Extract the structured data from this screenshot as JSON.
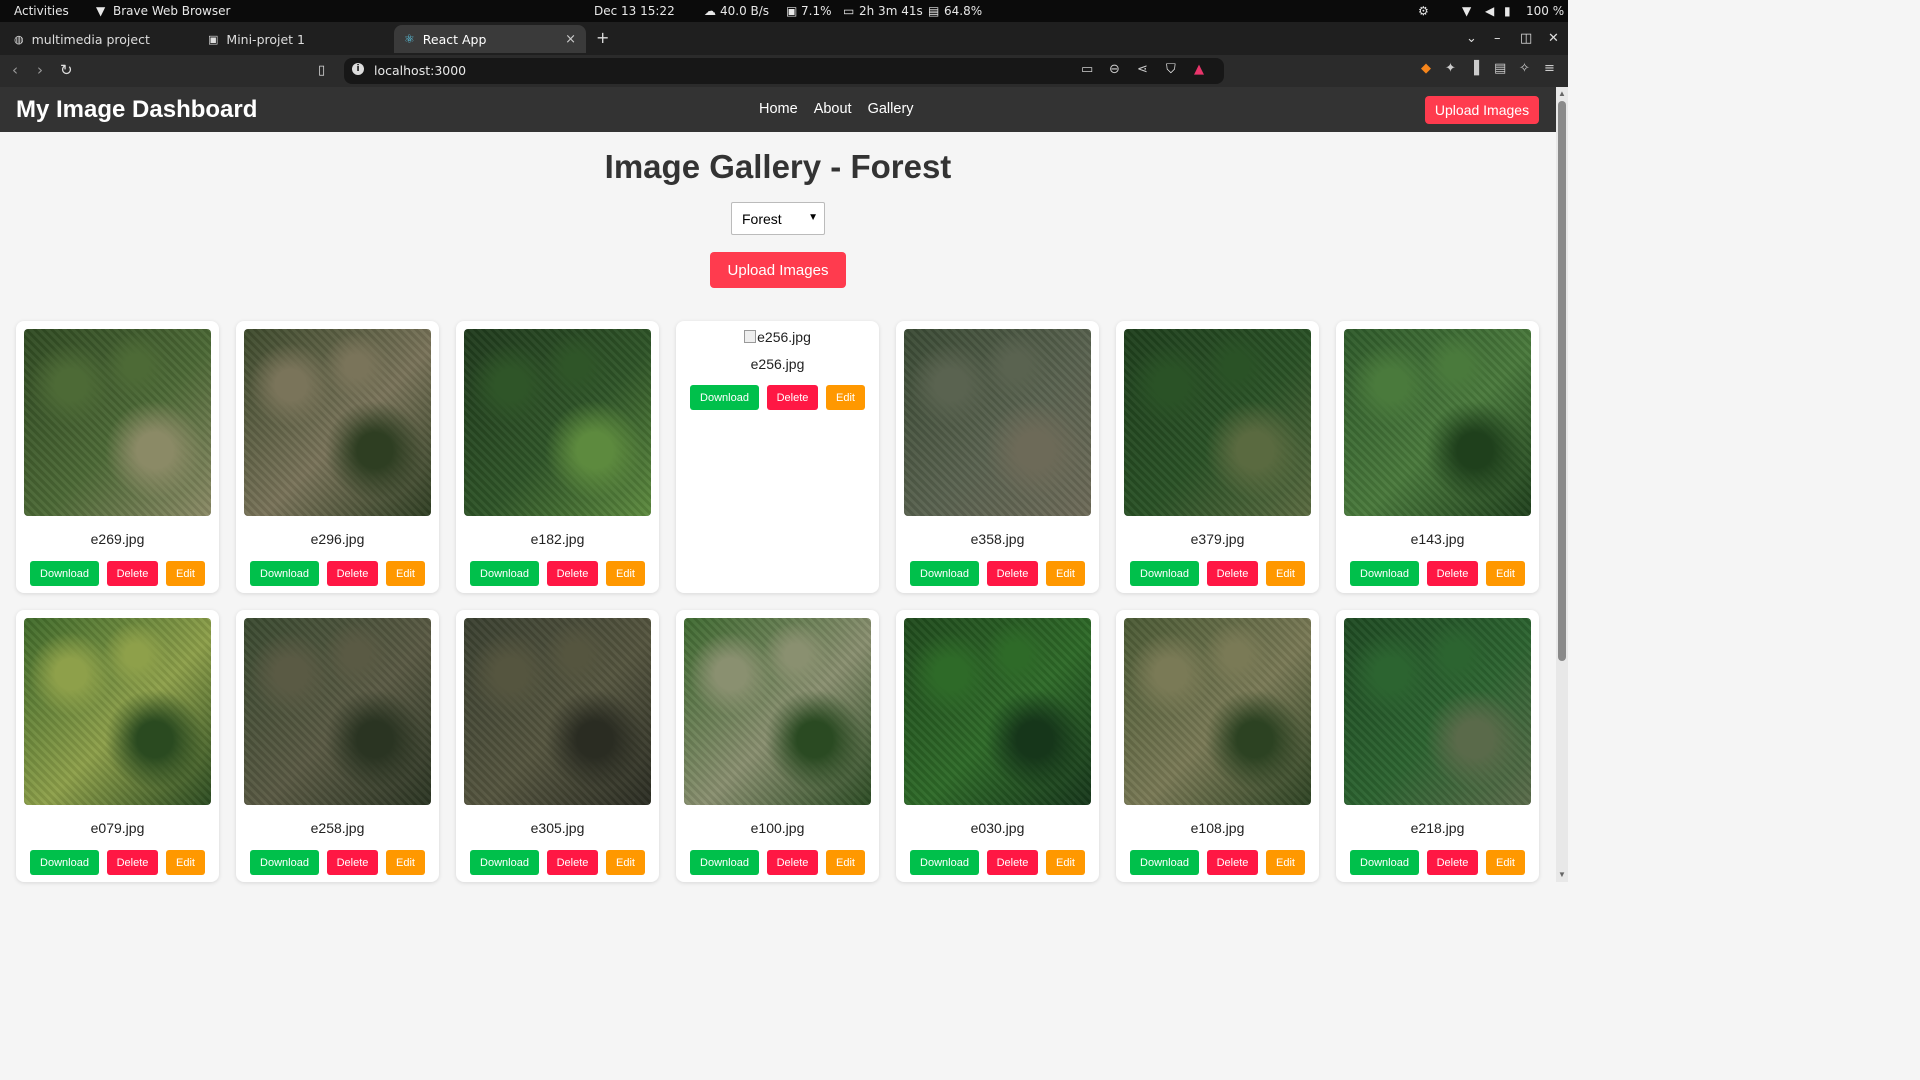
{
  "os_bar": {
    "activities": "Activities",
    "app_name": "Brave Web Browser",
    "datetime": "Dec 13  15:22",
    "net_speed": "40.0 B/s",
    "cpu": "7.1%",
    "uptime": "2h 3m 41s",
    "battery_usage": "64.8%",
    "volume": "100 %"
  },
  "tabs": [
    {
      "label": "multimedia project",
      "active": false
    },
    {
      "label": "Mini-projet 1",
      "active": false
    },
    {
      "label": "React App",
      "active": true
    }
  ],
  "tab_close": "×",
  "new_tab": "+",
  "address": {
    "url": "localhost:3000"
  },
  "header": {
    "brand": "My Image Dashboard",
    "nav": [
      "Home",
      "About",
      "Gallery"
    ],
    "upload_label": "Upload Images"
  },
  "gallery": {
    "title": "Image Gallery - Forest",
    "selected_category": "Forest",
    "upload_label": "Upload Images",
    "button_labels": {
      "download": "Download",
      "delete": "Delete",
      "edit": "Edit"
    },
    "images": [
      {
        "name": "e269.jpg",
        "loaded": true,
        "colors": [
          "#2f4a22",
          "#4d6a36",
          "#8b8a66"
        ]
      },
      {
        "name": "e296.jpg",
        "loaded": true,
        "colors": [
          "#3d4a2c",
          "#7a745a",
          "#2e3e22"
        ]
      },
      {
        "name": "e182.jpg",
        "loaded": true,
        "colors": [
          "#1f3a1c",
          "#2f5528",
          "#5d8a3e"
        ]
      },
      {
        "name": "e256.jpg",
        "loaded": false,
        "alt": "e256.jpg"
      },
      {
        "name": "e358.jpg",
        "loaded": true,
        "colors": [
          "#3a4a34",
          "#5a6350",
          "#6d6a58"
        ]
      },
      {
        "name": "e379.jpg",
        "loaded": true,
        "colors": [
          "#1e3f1c",
          "#2a5226",
          "#5a6a40"
        ]
      },
      {
        "name": "e143.jpg",
        "loaded": true,
        "colors": [
          "#2e5a2a",
          "#4a7a3c",
          "#1f401c"
        ]
      },
      {
        "name": "e079.jpg",
        "loaded": true,
        "colors": [
          "#3f6a2a",
          "#8ea04a",
          "#2a4a20"
        ]
      },
      {
        "name": "e258.jpg",
        "loaded": true,
        "colors": [
          "#3a4a30",
          "#5a5a44",
          "#2a3422"
        ]
      },
      {
        "name": "e305.jpg",
        "loaded": true,
        "colors": [
          "#3a4030",
          "#55553f",
          "#2a2c22"
        ]
      },
      {
        "name": "e100.jpg",
        "loaded": true,
        "colors": [
          "#3e6a30",
          "#8a9070",
          "#2a4a22"
        ]
      },
      {
        "name": "e030.jpg",
        "loaded": true,
        "colors": [
          "#1f4a1c",
          "#2e6a28",
          "#16361a"
        ]
      },
      {
        "name": "e108.jpg",
        "loaded": true,
        "colors": [
          "#4a5a34",
          "#7a7a56",
          "#2c4222"
        ]
      },
      {
        "name": "e218.jpg",
        "loaded": true,
        "colors": [
          "#1e4a22",
          "#2c6430",
          "#5a6a4a"
        ]
      }
    ]
  }
}
